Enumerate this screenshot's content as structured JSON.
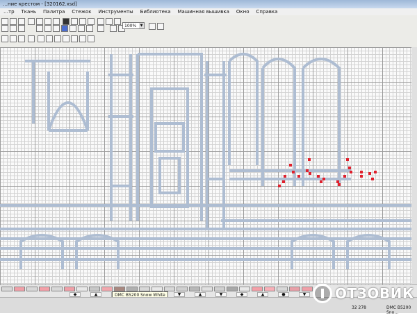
{
  "window": {
    "title": "…ние крестом - [320162.xsd]"
  },
  "menu": {
    "items": [
      "…тр",
      "Ткань",
      "Палитра",
      "Стежок",
      "Инструменты",
      "Библиотека",
      "Машинная вышивка",
      "Окно",
      "Справка"
    ]
  },
  "toolbar": {
    "zoom_value": "100%"
  },
  "palette": {
    "swatch_colors": [
      "#d8d8d8",
      "#f0a0a8",
      "#d8d8d8",
      "#f4a0a8",
      "#d8d8d8",
      "#f0a0a8",
      "#e8e8e8",
      "#c8c8c8",
      "#f2a8ae",
      "#a88880",
      "#b0b0b0",
      "#d8d8d8",
      "#e8e8e8",
      "#d8d8d8",
      "#d0d0d0",
      "#b8b8b8",
      "#e0e0e0",
      "#d0d0d0",
      "#a8a8a8",
      "#e8e8e8",
      "#f4a0a8",
      "#f8b0b8",
      "#d8d8d8",
      "#e8a0a8",
      "#f0a0a8"
    ],
    "symbols": [
      "◆",
      "▲",
      "▲",
      "▼",
      "▲",
      "▼",
      "▲",
      "▼",
      "◆",
      "▲",
      "●",
      "▼"
    ],
    "tooltip": "DMC B5200 Snow White"
  },
  "status": {
    "coords": "32   278",
    "color": "DMC B5200 Sno…"
  },
  "stitch_color": "#e0202c",
  "watermark": {
    "text": "ОТЗОВИК"
  }
}
